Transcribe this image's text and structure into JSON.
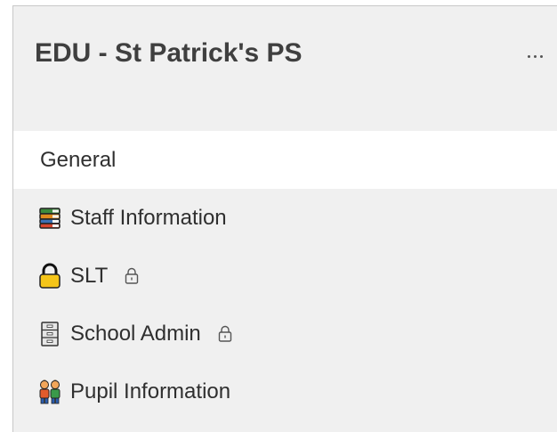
{
  "team": {
    "name": "EDU - St Patrick's PS",
    "more_icon": "more-options-icon"
  },
  "channels": [
    {
      "label": "General",
      "icon": null,
      "private": false,
      "active": true
    },
    {
      "label": "Staff Information",
      "icon": "books-icon",
      "private": false,
      "active": false
    },
    {
      "label": "SLT",
      "icon": "padlock-icon",
      "private": true,
      "active": false
    },
    {
      "label": "School Admin",
      "icon": "filing-cabinet-icon",
      "private": true,
      "active": false
    },
    {
      "label": "Pupil Information",
      "icon": "children-icon",
      "private": false,
      "active": false
    }
  ],
  "colors": {
    "panel_bg": "#f0f0f0",
    "active_bg": "#ffffff",
    "title": "#3f3f3f",
    "text": "#2f2f2f"
  }
}
